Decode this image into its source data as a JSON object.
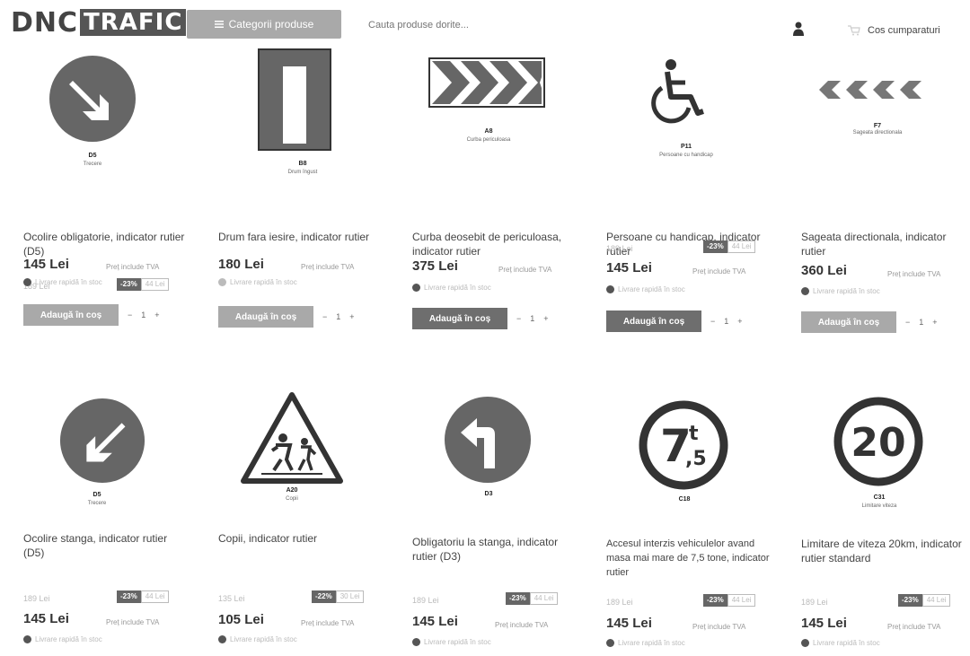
{
  "header": {
    "logo_dnc": "DNC",
    "logo_trafic": "TRAFIC",
    "categories_button": "Categorii produse",
    "search_placeholder": "Cauta produse dorite...",
    "cart_label": "Cos cumparaturi",
    "icons": [
      "menu-icon",
      "user-icon",
      "cart-icon"
    ]
  },
  "ui": {
    "add_to_cart": "Adaugă în coș",
    "vat": "Preț include TVA",
    "stock": "Livrare rapidă în stoc"
  },
  "products": [
    {
      "code": "D5",
      "sub": "Trecere",
      "name": "Ocolire obligatorie, indicator rutier (D5)",
      "old_price": "189 Lei",
      "discount": "-23%",
      "save": "44 Lei",
      "price": "145 Lei"
    },
    {
      "code": "B8",
      "sub": "Drum îngust",
      "name": "Drum fara iesire, indicator rutier",
      "old_price": "",
      "discount": "",
      "save": "",
      "price": "180 Lei"
    },
    {
      "code": "A8",
      "sub": "Curba periculoasa",
      "name": "Curba deosebit de periculoasa, indicator rutier",
      "old_price": "",
      "discount": "",
      "save": "",
      "price": "375 Lei"
    },
    {
      "code": "P11",
      "sub": "Persoane cu handicap",
      "name": "Persoane cu handicap, indicator rutier",
      "old_price": "189 Lei",
      "discount": "-23%",
      "save": "44 Lei",
      "price": "145 Lei"
    },
    {
      "code": "F7",
      "sub": "Sageata directionala",
      "name": "Sageata directionala, indicator rutier",
      "old_price": "",
      "discount": "",
      "save": "",
      "price": "360 Lei"
    },
    {
      "code": "D5",
      "sub": "Trecere",
      "name": "Ocolire stanga, indicator rutier (D5)",
      "old_price": "189 Lei",
      "discount": "-23%",
      "save": "44 Lei",
      "price": "145 Lei"
    },
    {
      "code": "A20",
      "sub": "Copii",
      "name": "Copii, indicator rutier",
      "old_price": "135 Lei",
      "discount": "-22%",
      "save": "30 Lei",
      "price": "105 Lei"
    },
    {
      "code": "D3",
      "sub": "",
      "name": "Obligatoriu la stanga, indicator rutier (D3)",
      "old_price": "189 Lei",
      "discount": "-23%",
      "save": "44 Lei",
      "price": "145 Lei"
    },
    {
      "code": "C18",
      "sub": "",
      "name": "Accesul interzis vehiculelor avand masa mai mare de 7,5 tone, indicator rutier",
      "old_price": "189 Lei",
      "discount": "-23%",
      "save": "44 Lei",
      "price": "145 Lei"
    },
    {
      "code": "C31",
      "sub": "Limitare viteza",
      "name": "Limitare de viteza 20km, indicator rutier standard",
      "old_price": "189 Lei",
      "discount": "-23%",
      "save": "44 Lei",
      "price": "145 Lei"
    }
  ],
  "sign_text": {
    "weight_main": "7",
    "weight_sup": "t",
    "weight_sub": ",5",
    "speed": "20"
  },
  "colors": {
    "sign_fill": "#666666",
    "sign_border": "#333333",
    "button_gray": "#a9a9a9",
    "button_dark": "#6e6e6e"
  }
}
